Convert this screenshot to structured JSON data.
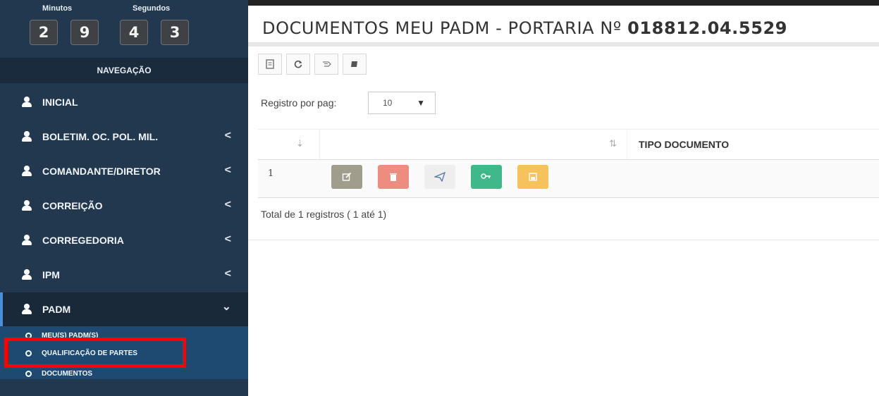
{
  "timer": {
    "minutes_label": "Minutos",
    "seconds_label": "Segundos",
    "digits": [
      "2",
      "9",
      "4",
      "3"
    ]
  },
  "sidebar": {
    "nav_header": "NAVEGAÇÃO",
    "items": [
      {
        "label": "INICIAL"
      },
      {
        "label": "BOLETIM. OC. POL. MIL.",
        "chevron": "<"
      },
      {
        "label": "COMANDANTE/DIRETOR",
        "chevron": "<"
      },
      {
        "label": "CORREIÇÃO",
        "chevron": "<"
      },
      {
        "label": "CORREGEDORIA",
        "chevron": "<"
      },
      {
        "label": "IPM",
        "chevron": "<"
      },
      {
        "label": "PADM",
        "chevron": "⌄"
      }
    ],
    "sub_items": [
      {
        "label": "MEU(S) PADM(S)"
      },
      {
        "label": "QUALIFICAÇÃO DE PARTES"
      },
      {
        "label": "DOCUMENTOS"
      }
    ]
  },
  "main": {
    "title_prefix": "DOCUMENTOS MEU PADM - PORTARIA Nº ",
    "title_number": "018812.04.5529",
    "per_page_label": "Registro por pag:",
    "per_page_value": "10",
    "table": {
      "header_tipo": "TIPO DOCUMENTO",
      "rows": [
        {
          "num": "1"
        }
      ]
    },
    "total": "Total de 1 registros ( 1 até 1)"
  },
  "colors": {
    "sidebar_bg": "#22384f",
    "edit_btn": "#a19d8d",
    "delete_btn": "#ec8d7f",
    "key_btn": "#3fb98a",
    "save_btn": "#f5c25c",
    "highlight": "#ff0000"
  }
}
